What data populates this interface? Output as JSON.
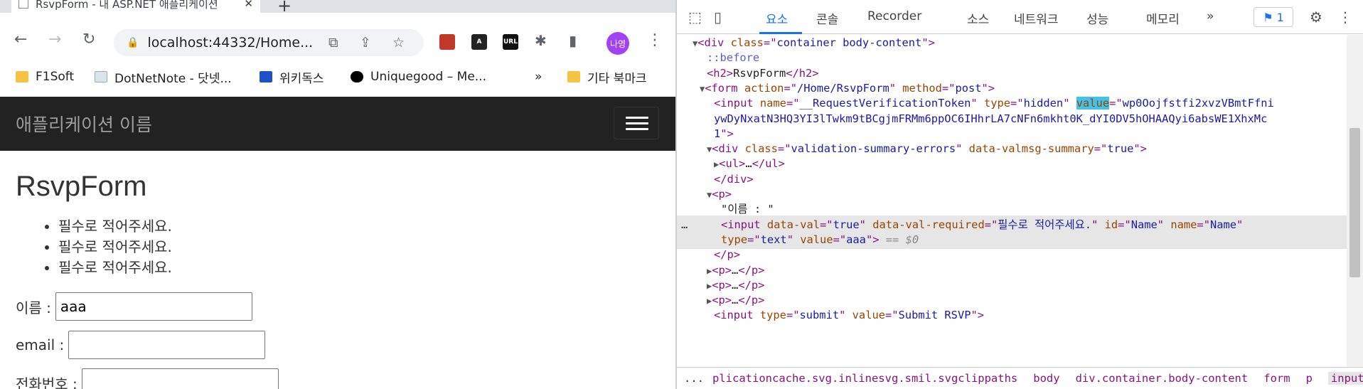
{
  "browser": {
    "tab_title": "RsvpForm - 내 ASP.NET 애플리케이션",
    "url": "localhost:44332/Home...",
    "profile_label": "나영",
    "bookmarks": [
      "F1Soft",
      "DotNetNote - 닷넷...",
      "위키독스",
      "Uniquegood – Me...",
      "»",
      "기타 북마크"
    ],
    "extensions": [
      "URL"
    ]
  },
  "page": {
    "brand": "애플리케이션 이름",
    "heading": "RsvpForm",
    "errors": [
      "필수로 적어주세요.",
      "필수로 적어주세요.",
      "필수로 적어주세요."
    ],
    "fields": [
      {
        "label": "이름 :",
        "value": "aaa"
      },
      {
        "label": "email :",
        "value": ""
      },
      {
        "label": "전화번호 :",
        "value": ""
      }
    ]
  },
  "devtools": {
    "tabs": [
      "요소",
      "콘솔",
      "Recorder",
      "소스",
      "네트워크",
      "성능",
      "메모리",
      "»"
    ],
    "issues_count": "1",
    "lines": [
      {
        "indent": 3,
        "html": "<span class='tri'>▼</span><span class='tag'>&lt;div </span><span class='attr'>class</span><span class='tag'>=\"</span><span class='val'>container body-content</span><span class='tag'>\"&gt;</span>"
      },
      {
        "indent": 5,
        "html": "<span class='pseudo'>::before</span>"
      },
      {
        "indent": 5,
        "html": "<span class='tag'>&lt;h2&gt;</span><span class='txt'>RsvpForm</span><span class='tag'>&lt;/h2&gt;</span>"
      },
      {
        "indent": 4,
        "html": "<span class='tri'>▼</span><span class='tag'>&lt;form </span><span class='attr'>action</span><span class='tag'>=\"</span><span class='val'>/Home/RsvpForm</span><span class='tag'>\" </span><span class='attr'>method</span><span class='tag'>=\"</span><span class='val'>post</span><span class='tag'>\"&gt;</span>"
      },
      {
        "indent": 6,
        "html": "<span class='tag'>&lt;input </span><span class='attr'>name</span><span class='tag'>=\"</span><span class='val'>__RequestVerificationToken</span><span class='tag'>\" </span><span class='attr'>type</span><span class='tag'>=\"</span><span class='val'>hidden</span><span class='tag'>\" </span><span class='attr hl'>value</span><span class='tag'>=\"</span><span class='val'>wp0Oojfstfi2xvzVBmtFfni</span>"
      },
      {
        "indent": 6,
        "html": "<span class='val'>ywDyNxatN3HQ3YI3lTwkm9tBCgjmFRMm6ppOC6IHhrLA7cNFn6mkht0K_dYI0DV5hOHAAQyi6absWE1XhxMc</span>"
      },
      {
        "indent": 6,
        "html": "<span class='val'>1</span><span class='tag'>\"&gt;</span>"
      },
      {
        "indent": 5,
        "html": "<span class='tri'>▼</span><span class='tag'>&lt;div </span><span class='attr'>class</span><span class='tag'>=\"</span><span class='val'>validation-summary-errors</span><span class='tag'>\" </span><span class='attr'>data-valmsg-summary</span><span class='tag'>=\"</span><span class='val'>true</span><span class='tag'>\"&gt;</span>"
      },
      {
        "indent": 6,
        "html": "<span class='tri'>▶</span><span class='tag'>&lt;ul&gt;</span><span class='txt'>…</span><span class='tag'>&lt;/ul&gt;</span>"
      },
      {
        "indent": 6,
        "html": "<span class='tag'>&lt;/div&gt;</span>"
      },
      {
        "indent": 5,
        "html": "<span class='tri'>▼</span><span class='tag'>&lt;p&gt;</span>"
      },
      {
        "indent": 7,
        "html": "<span class='txt'>\"이름 : \"</span>"
      },
      {
        "indent": 7,
        "sel": true,
        "html": "<span class='tag'>&lt;input </span><span class='attr'>data-val</span><span class='tag'>=\"</span><span class='val'>true</span><span class='tag'>\" </span><span class='attr'>data-val-required</span><span class='tag'>=\"</span><span class='val'>필수로 적어주세요.</span><span class='tag'>\" </span><span class='attr'>id</span><span class='tag'>=\"</span><span class='val'>Name</span><span class='tag'>\" </span><span class='attr'>name</span><span class='tag'>=\"</span><span class='val'>Name</span><span class='tag'>\"</span>"
      },
      {
        "indent": 7,
        "sel": true,
        "html": "<span class='attr'>type</span><span class='tag'>=\"</span><span class='val'>text</span><span class='tag'>\" </span><span class='attr'>value</span><span class='tag'>=\"</span><span class='val'>aaa</span><span class='tag'>\"&gt;</span> <span class='dollar'>== $0</span>"
      },
      {
        "indent": 6,
        "html": "<span class='tag'>&lt;/p&gt;</span>"
      },
      {
        "indent": 5,
        "html": "<span class='tri'>▶</span><span class='tag'>&lt;p&gt;</span><span class='txt'>…</span><span class='tag'>&lt;/p&gt;</span>"
      },
      {
        "indent": 5,
        "html": "<span class='tri'>▶</span><span class='tag'>&lt;p&gt;</span><span class='txt'>…</span><span class='tag'>&lt;/p&gt;</span>"
      },
      {
        "indent": 5,
        "html": "<span class='tri'>▶</span><span class='tag'>&lt;p&gt;</span><span class='txt'>…</span><span class='tag'>&lt;/p&gt;</span>"
      },
      {
        "indent": 6,
        "html": "<span class='tag'>&lt;input </span><span class='attr'>type</span><span class='tag'>=\"</span><span class='val'>submit</span><span class='tag'>\" </span><span class='attr'>value</span><span class='tag'>=\"</span><span class='val'>Submit RSVP</span><span class='tag'>\"&gt;</span>"
      }
    ],
    "breadcrumb": [
      "...",
      "plicationcache.svg.inlinesvg.smil.svgclippaths",
      "body",
      "div.container.body-content",
      "form",
      "p",
      "input#Name"
    ]
  }
}
